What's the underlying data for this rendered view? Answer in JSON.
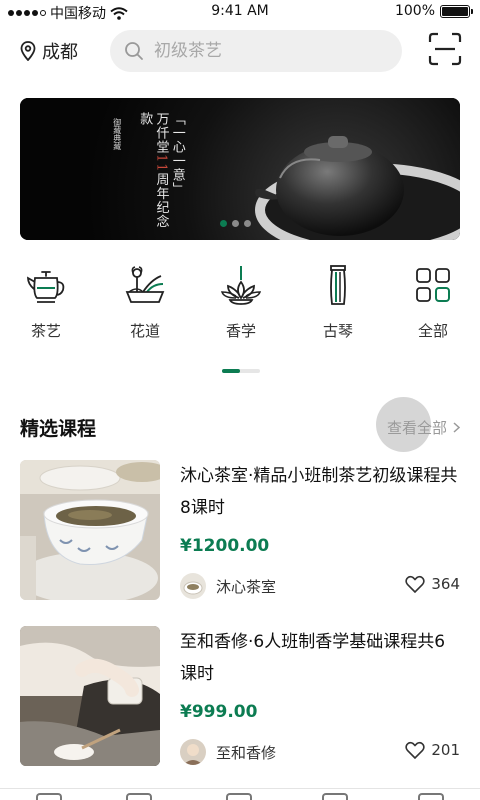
{
  "status_bar": {
    "carrier": "中国移动",
    "time": "9:41 AM",
    "battery": "100%"
  },
  "header": {
    "location": "成都",
    "search_placeholder": "初级茶艺"
  },
  "banner": {
    "main_text": [
      "「一心一意」",
      "万仟堂11周年纪念款"
    ],
    "red_text": "11",
    "sub_text": "御藏典藏",
    "slide_count": 3,
    "active_slide": 0
  },
  "categories": [
    {
      "label": "茶艺",
      "icon": "teapot-icon"
    },
    {
      "label": "花道",
      "icon": "flower-arrangement-icon"
    },
    {
      "label": "香学",
      "icon": "incense-lotus-icon"
    },
    {
      "label": "古琴",
      "icon": "guqin-icon"
    },
    {
      "label": "全部",
      "icon": "grid-all-icon"
    }
  ],
  "section": {
    "title": "精选课程",
    "more": "查看全部"
  },
  "courses": [
    {
      "title": "沐心茶室·精品小班制茶艺初级课程共8课时",
      "price": "¥1200.00",
      "shop": "沐心茶室",
      "likes": "364"
    },
    {
      "title": "至和香修·6人班制香学基础课程共6课时",
      "price": "¥999.00",
      "shop": "至和香修",
      "likes": "201"
    }
  ],
  "colors": {
    "accent": "#0c7c52",
    "search_bg": "#efefef",
    "muted": "#9a9a9a"
  }
}
